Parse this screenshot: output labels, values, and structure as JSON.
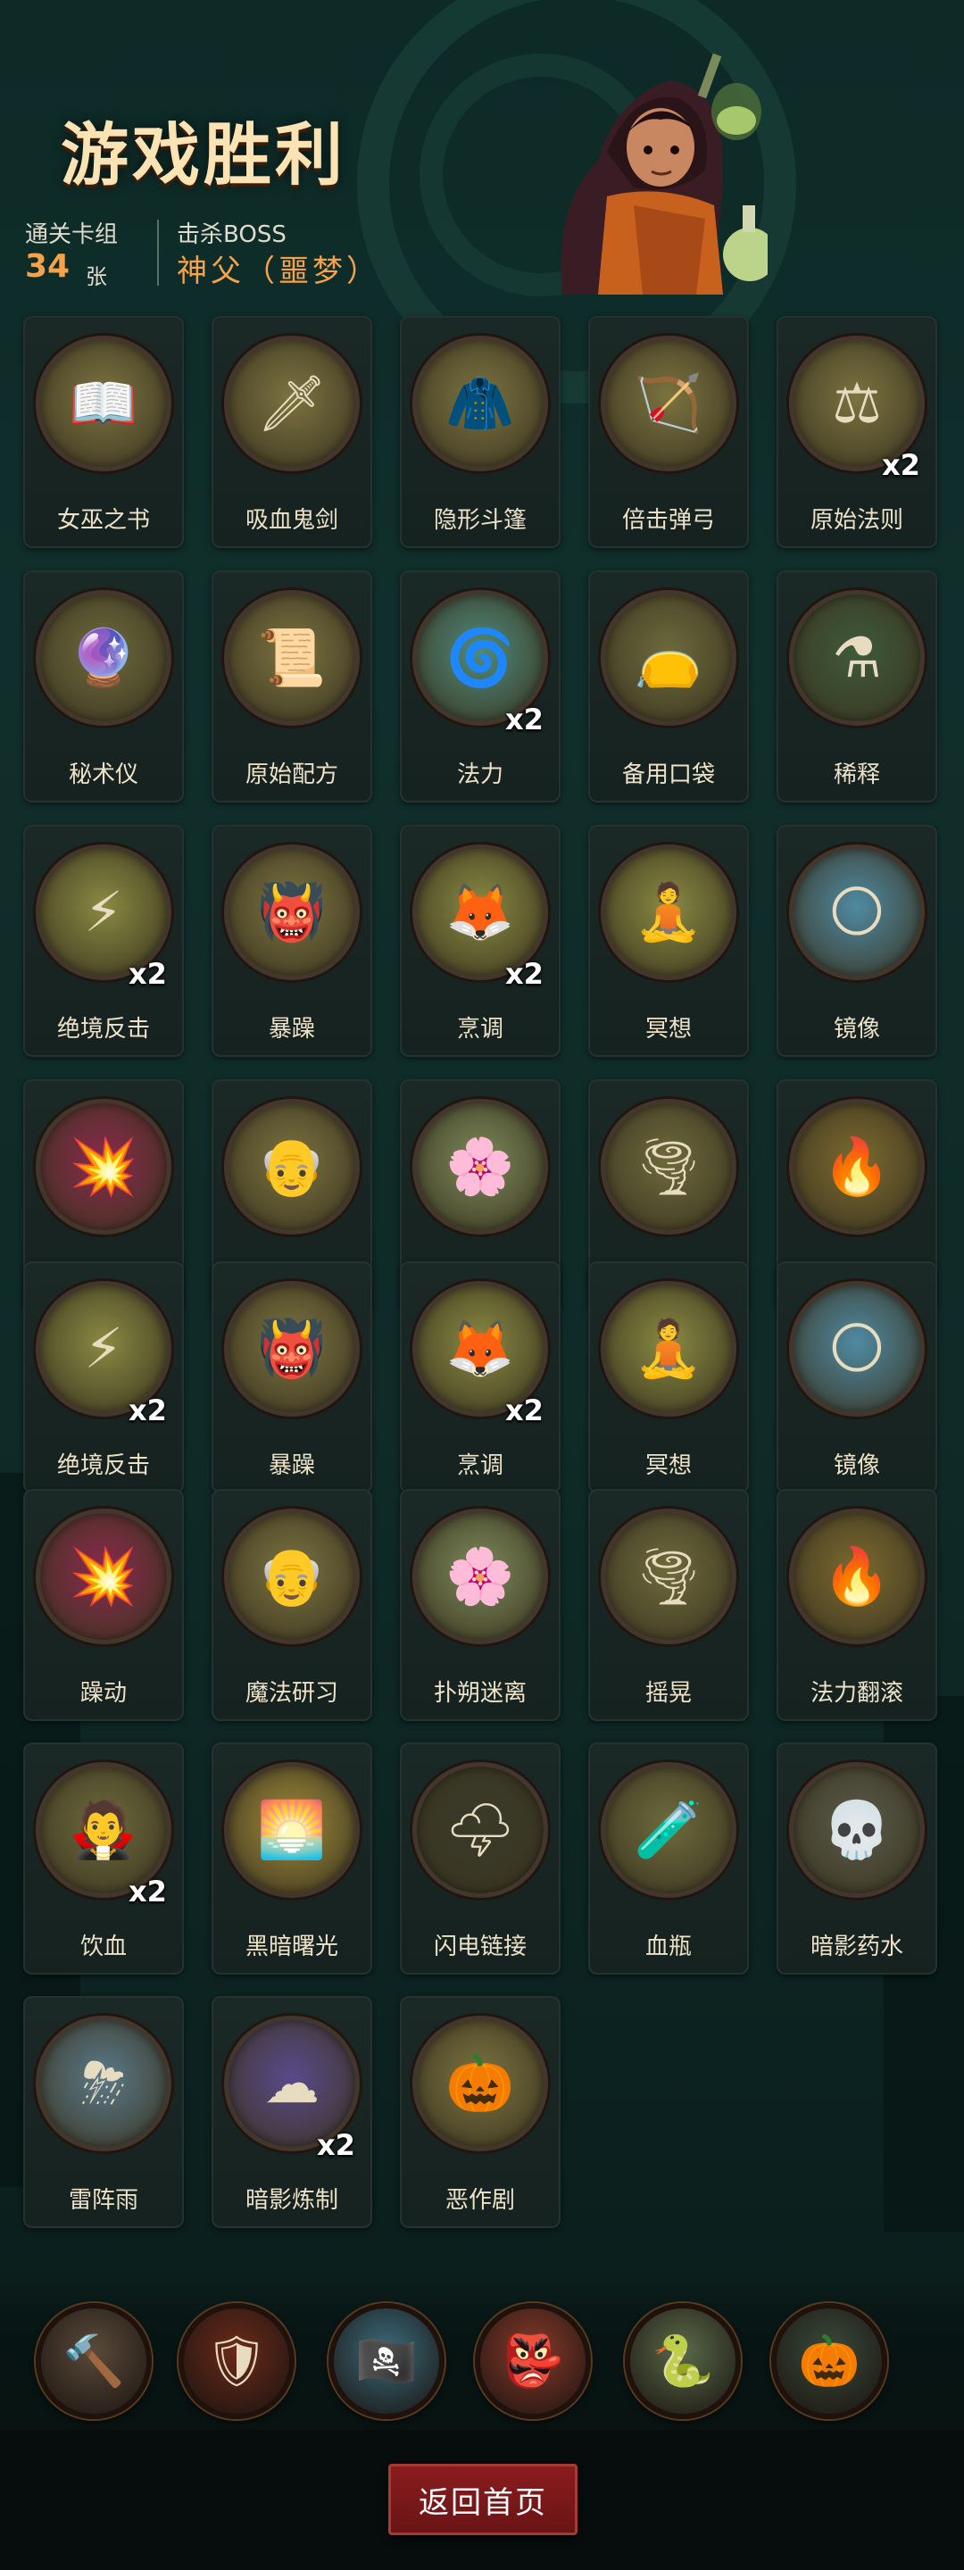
{
  "header": {
    "title": "游戏胜利",
    "deck_label": "通关卡组",
    "deck_count": "34",
    "deck_unit": "张",
    "boss_label": "击杀BOSS",
    "boss_name": "神父（噩梦）"
  },
  "colors": {
    "accent_orange": "#f5a24a",
    "title": "#fbe3b3",
    "button_red": "#7a181a"
  },
  "cards": [
    {
      "name": "女巫之书",
      "count": "",
      "icon": "book-skull-icon",
      "glyph": "📖",
      "bg": "#7c7340"
    },
    {
      "name": "吸血鬼剑",
      "count": "",
      "icon": "vampire-sword-icon",
      "glyph": "🗡",
      "bg": "#7c7340"
    },
    {
      "name": "隐形斗篷",
      "count": "",
      "icon": "cloak-icon",
      "glyph": "🧥",
      "bg": "#7c7340"
    },
    {
      "name": "倍击弹弓",
      "count": "",
      "icon": "slingshot-icon",
      "glyph": "🏹",
      "bg": "#7c7340"
    },
    {
      "name": "原始法则",
      "count": "x2",
      "icon": "scales-icon",
      "glyph": "⚖",
      "bg": "#7c7340"
    },
    {
      "name": "秘术仪",
      "count": "",
      "icon": "ritual-cauldron-icon",
      "glyph": "🔮",
      "bg": "#6e6a3c"
    },
    {
      "name": "原始配方",
      "count": "",
      "icon": "scroll-icon",
      "glyph": "📜",
      "bg": "#7c7340"
    },
    {
      "name": "法力",
      "count": "x2",
      "icon": "mana-orb-icon",
      "glyph": "🌀",
      "bg": "#4f8a7a"
    },
    {
      "name": "备用口袋",
      "count": "",
      "icon": "pouch-icon",
      "glyph": "👝",
      "bg": "#6e6a3c"
    },
    {
      "name": "稀释",
      "count": "",
      "icon": "potion-witch-icon",
      "glyph": "⚗",
      "bg": "#3f5a3a"
    },
    {
      "name": "绝境反击",
      "count": "x2",
      "icon": "counterattack-icon",
      "glyph": "⚡",
      "bg": "#8a8a42"
    },
    {
      "name": "暴躁",
      "count": "",
      "icon": "angry-ogre-icon",
      "glyph": "👹",
      "bg": "#7c7340"
    },
    {
      "name": "烹调",
      "count": "x2",
      "icon": "fox-cook-icon",
      "glyph": "🦊",
      "bg": "#8a8a42"
    },
    {
      "name": "冥想",
      "count": "",
      "icon": "meditation-icon",
      "glyph": "🧘",
      "bg": "#8a8a42"
    },
    {
      "name": "镜像",
      "count": "",
      "icon": "moon-water-icon",
      "glyph": "🌕",
      "bg": "#4f8aa2"
    },
    {
      "name": "躁动",
      "count": "",
      "icon": "frenzy-icon",
      "glyph": "💥",
      "bg": "#8a2a4a"
    },
    {
      "name": "魔法研习",
      "count": "",
      "icon": "scholar-icon",
      "glyph": "👴",
      "bg": "#7c7340"
    },
    {
      "name": "扑朔迷离",
      "count": "",
      "icon": "vortex-flower-icon",
      "glyph": "🌸",
      "bg": "#7c8a5a"
    },
    {
      "name": "摇晃",
      "count": "",
      "icon": "shaking-icon",
      "glyph": "🌪",
      "bg": "#6e6a3c"
    },
    {
      "name": "法力翻滚",
      "count": "",
      "icon": "fire-bowl-icon",
      "glyph": "🔥",
      "bg": "#7c6a30"
    },
    {
      "name": "绝境反击",
      "count": "x2",
      "icon": "counterattack-icon",
      "glyph": "⚡",
      "bg": "#8a8a42"
    },
    {
      "name": "暴躁",
      "count": "",
      "icon": "angry-ogre-icon",
      "glyph": "👹",
      "bg": "#7c7340"
    },
    {
      "name": "烹调",
      "count": "x2",
      "icon": "fox-cook-icon",
      "glyph": "🦊",
      "bg": "#8a8a42"
    },
    {
      "name": "冥想",
      "count": "",
      "icon": "meditation-icon",
      "glyph": "🧘",
      "bg": "#8a8a42"
    },
    {
      "name": "镜像",
      "count": "",
      "icon": "moon-water-icon",
      "glyph": "🌕",
      "bg": "#4f8aa2"
    },
    {
      "name": "躁动",
      "count": "",
      "icon": "frenzy-icon",
      "glyph": "💥",
      "bg": "#8a2a4a"
    },
    {
      "name": "魔法研习",
      "count": "",
      "icon": "scholar-icon",
      "glyph": "👴",
      "bg": "#7c7340"
    },
    {
      "name": "扑朔迷离",
      "count": "",
      "icon": "vortex-flower-icon",
      "glyph": "🌸",
      "bg": "#7c8a5a"
    },
    {
      "name": "摇晃",
      "count": "",
      "icon": "shaking-icon",
      "glyph": "🌪",
      "bg": "#6e6a3c"
    },
    {
      "name": "法力翻滚",
      "count": "",
      "icon": "fire-bowl-icon",
      "glyph": "🔥",
      "bg": "#7c6a30"
    },
    {
      "name": "饮血",
      "count": "x2",
      "icon": "vampire-icon",
      "glyph": "🧛",
      "bg": "#6e6a3c"
    },
    {
      "name": "黑暗曙光",
      "count": "",
      "icon": "dark-dawn-icon",
      "glyph": "🌅",
      "bg": "#a08a3a"
    },
    {
      "name": "闪电链接",
      "count": "",
      "icon": "lightning-chain-icon",
      "glyph": "🌩",
      "bg": "#3a3a2a"
    },
    {
      "name": "血瓶",
      "count": "",
      "icon": "blood-potion-icon",
      "glyph": "🧪",
      "bg": "#6e6a3c"
    },
    {
      "name": "暗影药水",
      "count": "",
      "icon": "reaper-potion-icon",
      "glyph": "💀",
      "bg": "#5a5a4a"
    },
    {
      "name": "雷阵雨",
      "count": "",
      "icon": "storm-rain-icon",
      "glyph": "⛈",
      "bg": "#5a7a8a"
    },
    {
      "name": "暗影炼制",
      "count": "x2",
      "icon": "shadow-brew-icon",
      "glyph": "☁",
      "bg": "#5a4a8a"
    },
    {
      "name": "恶作剧",
      "count": "",
      "icon": "prank-doll-icon",
      "glyph": "🎃",
      "bg": "#7c7340"
    }
  ],
  "bosses": [
    {
      "icon": "hammer-boss-icon",
      "glyph": "🔨",
      "bg": "#5a4a3a"
    },
    {
      "icon": "shield-boss-icon",
      "glyph": "🛡",
      "bg": "#6a2a1a"
    },
    {
      "icon": "pirate-boss-icon",
      "glyph": "🏴‍☠️",
      "bg": "#3a6a7a"
    },
    {
      "icon": "priest-boss-icon",
      "glyph": "👺",
      "bg": "#8a3a2a"
    },
    {
      "icon": "medusa-boss-icon",
      "glyph": "🐍",
      "bg": "#5a6a4a"
    },
    {
      "icon": "pumpkin-boss-icon",
      "glyph": "🎃",
      "bg": "#3a4a3a"
    }
  ],
  "footer": {
    "home_button": "返回首页"
  }
}
